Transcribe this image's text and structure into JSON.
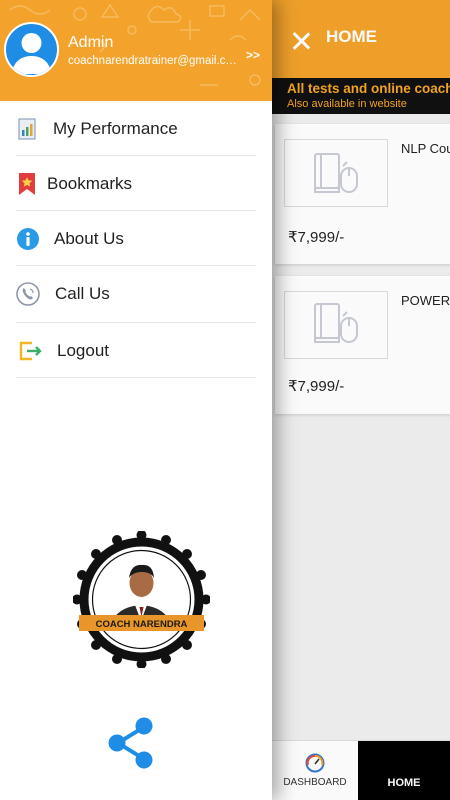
{
  "appbar": {
    "title": "HOME"
  },
  "promo": {
    "line1": "All tests and online coach",
    "line2": "Also available in website"
  },
  "courses": [
    {
      "name": "NLP Cou",
      "price": "₹7,999/-"
    },
    {
      "name": "POWER",
      "price": "₹7,999/-"
    }
  ],
  "bottom_nav": {
    "dashboard": "DASHBOARD",
    "home": "HOME"
  },
  "drawer": {
    "user_name": "Admin",
    "user_email": "coachnarendratrainer@gmail.com",
    "expand": ">>",
    "menu": [
      {
        "label": "My Performance",
        "icon": "performance-icon"
      },
      {
        "label": "Bookmarks",
        "icon": "bookmark-icon"
      },
      {
        "label": "About Us",
        "icon": "info-icon"
      },
      {
        "label": "Call Us",
        "icon": "phone-icon"
      },
      {
        "label": "Logout",
        "icon": "logout-icon"
      }
    ],
    "logo_text": "COACH NARENDRA"
  },
  "colors": {
    "accent": "#f3a32b",
    "promo_text": "#f5a623",
    "share": "#1f8de6"
  }
}
